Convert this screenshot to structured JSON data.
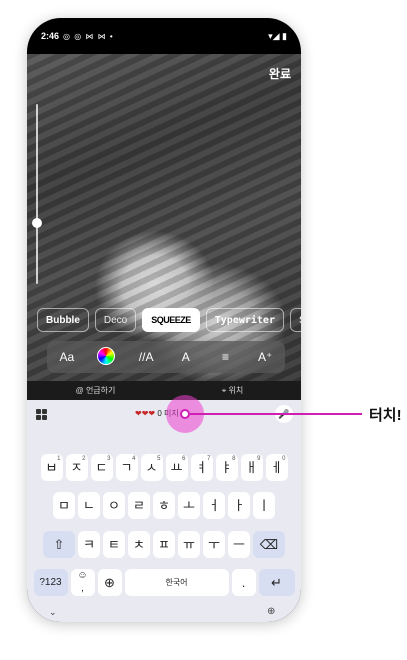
{
  "status_bar": {
    "time": "2:46",
    "notifications": "◎ ◎ ⋈ ⋈ •",
    "system": "▾◢ ▮"
  },
  "editor": {
    "done_label": "완료"
  },
  "font_styles": [
    "Bubble",
    "Deco",
    "SQUEEZE",
    "Typewriter",
    "S"
  ],
  "tools": {
    "aa_label": "Aa",
    "italic_label": "//A",
    "outline_label": "A",
    "align_label": "≡",
    "effects_label": "A⁺"
  },
  "mention_bar": {
    "mention_label": "언급하기",
    "location_label": "위치"
  },
  "keyboard": {
    "suggestion": "0 미지",
    "row1": [
      {
        "k": "ㅂ",
        "n": "1"
      },
      {
        "k": "ㅈ",
        "n": "2"
      },
      {
        "k": "ㄷ",
        "n": "3"
      },
      {
        "k": "ㄱ",
        "n": "4"
      },
      {
        "k": "ㅅ",
        "n": "5"
      },
      {
        "k": "ㅛ",
        "n": "6"
      },
      {
        "k": "ㅕ",
        "n": "7"
      },
      {
        "k": "ㅑ",
        "n": "8"
      },
      {
        "k": "ㅐ",
        "n": "9"
      },
      {
        "k": "ㅔ",
        "n": "0"
      }
    ],
    "row2": [
      "ㅁ",
      "ㄴ",
      "ㅇ",
      "ㄹ",
      "ㅎ",
      "ㅗ",
      "ㅓ",
      "ㅏ",
      "ㅣ"
    ],
    "row3": [
      "ㅋ",
      "ㅌ",
      "ㅊ",
      "ㅍ",
      "ㅠ",
      "ㅜ",
      "ㅡ"
    ],
    "sym_label": "?123",
    "space_label": "한국어",
    "period_label": ".",
    "comma_label": ",",
    "emoji_label": "☺"
  },
  "annotation": {
    "label": "터치!"
  }
}
